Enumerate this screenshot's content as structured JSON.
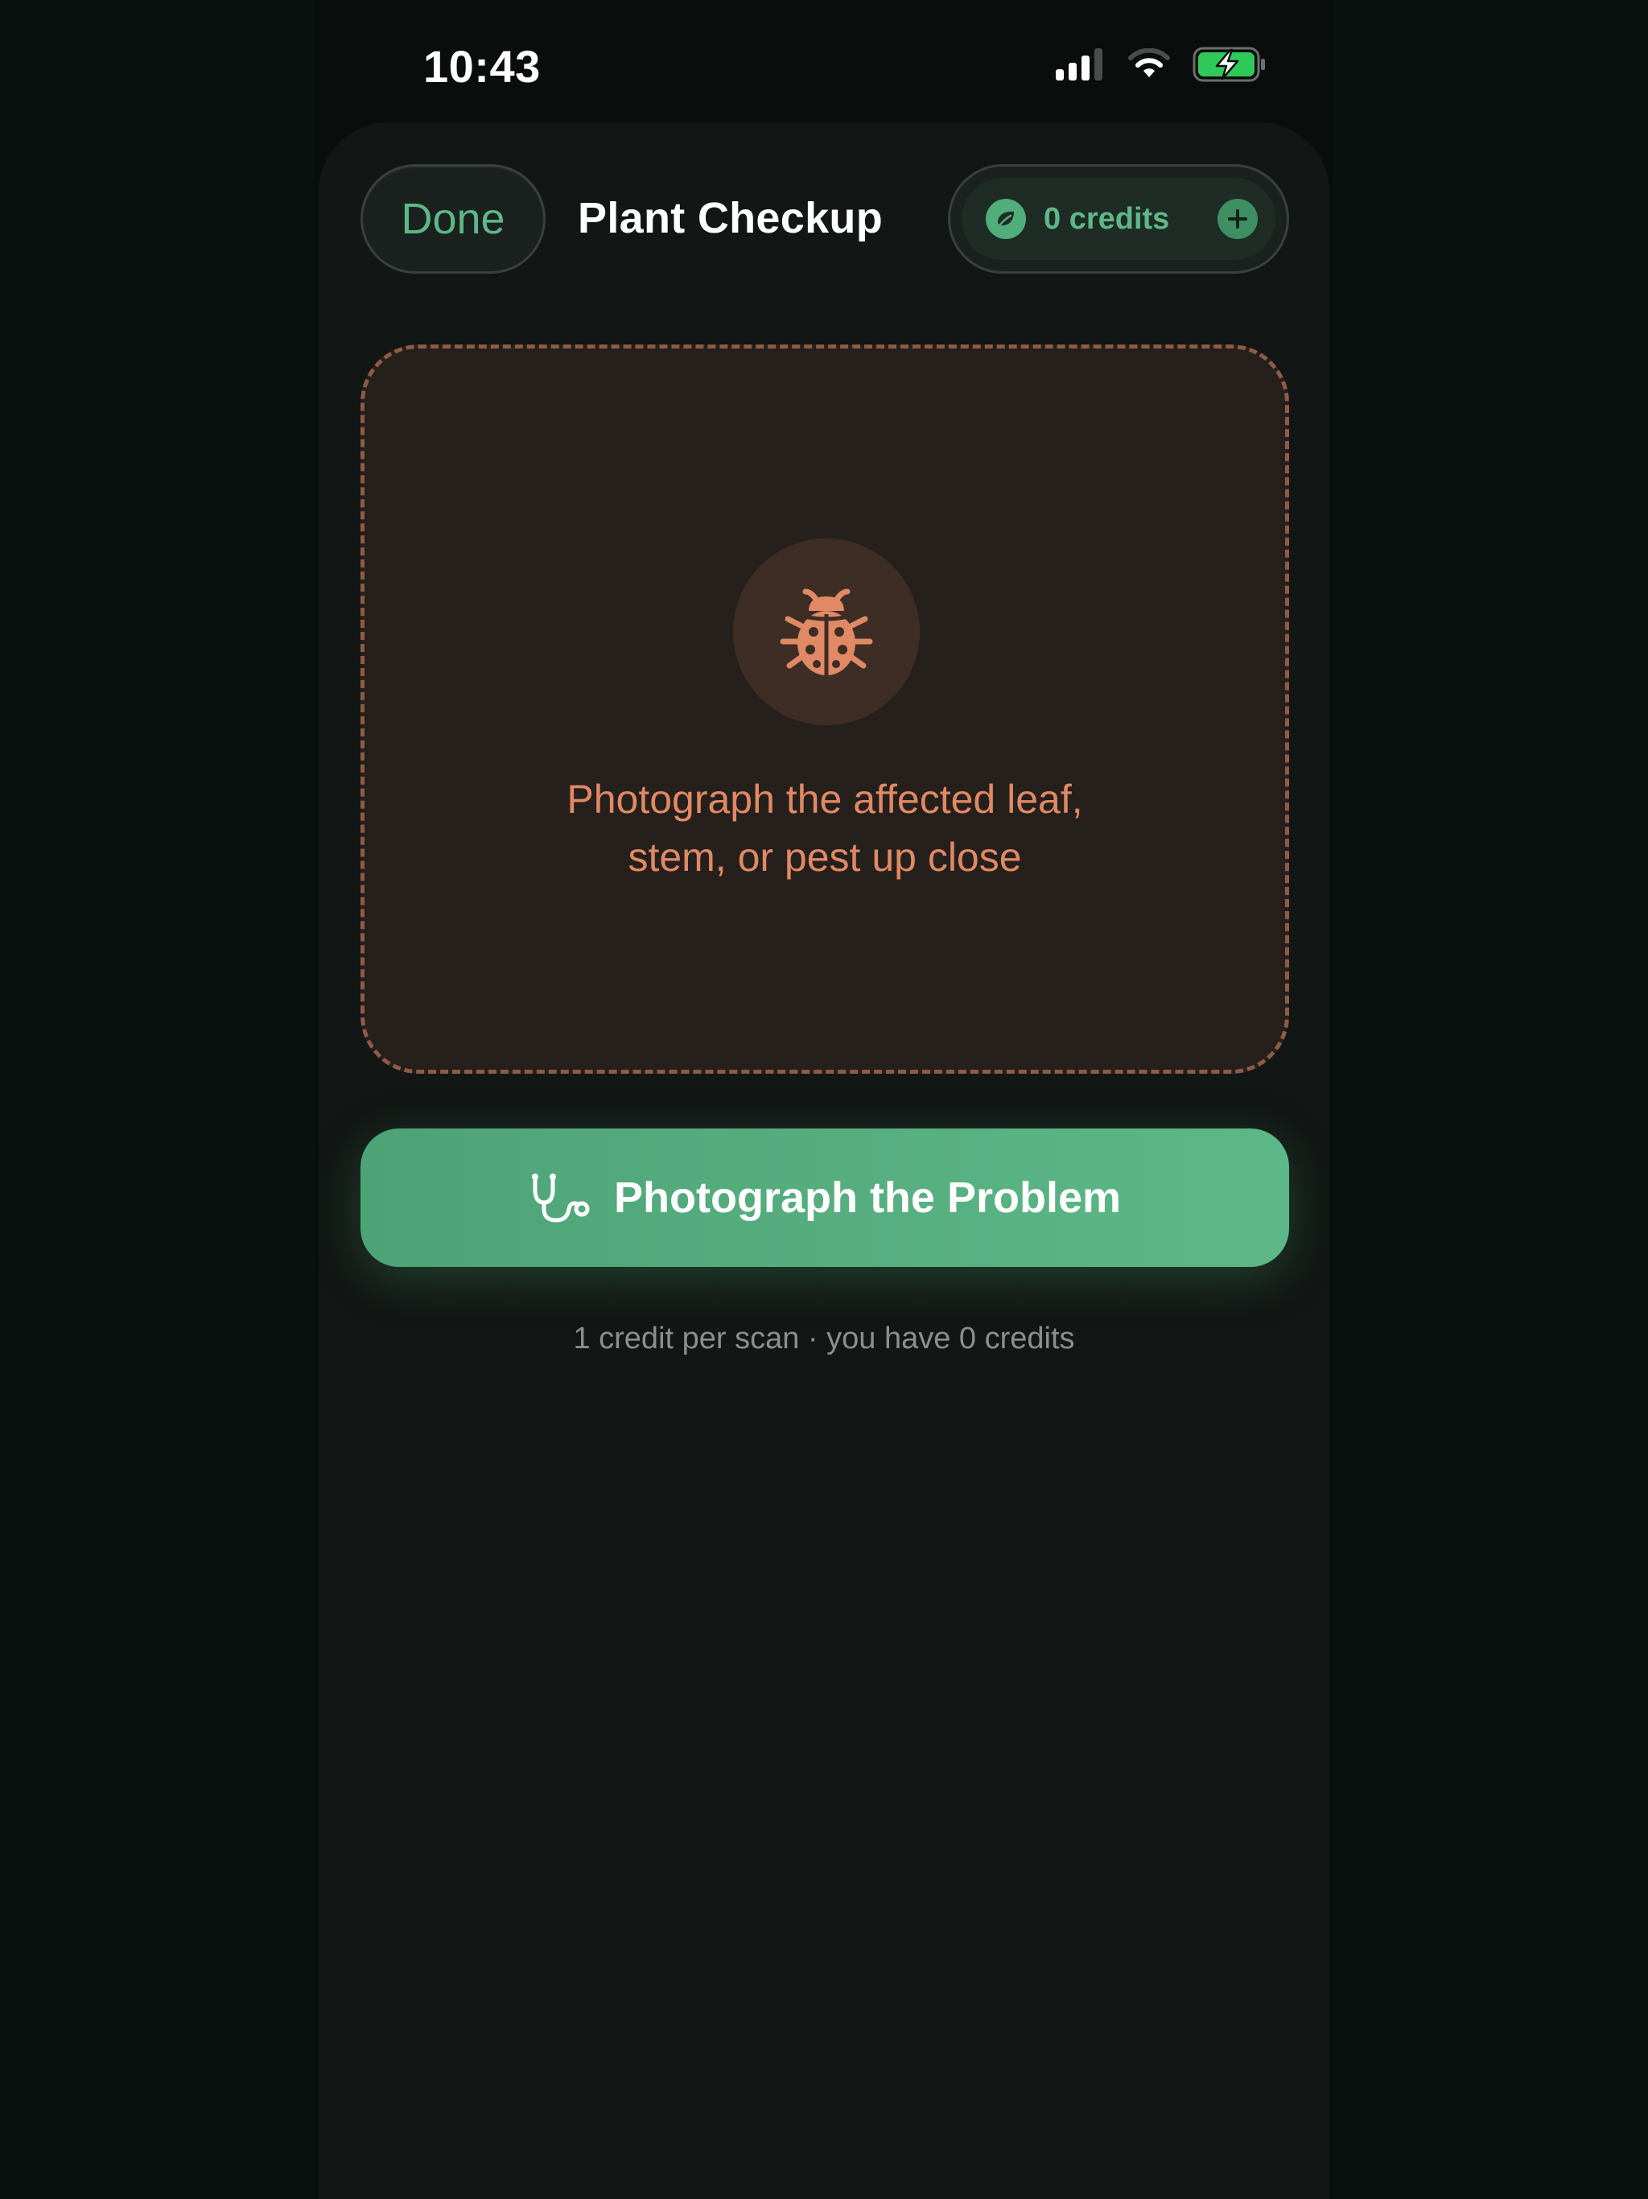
{
  "status_bar": {
    "time": "10:43",
    "icons": [
      "cellular-signal-icon",
      "wifi-icon",
      "battery-charging-icon"
    ],
    "battery_color": "#2fc95a"
  },
  "header": {
    "done_label": "Done",
    "title": "Plant Checkup",
    "credits_label": "0 credits",
    "credits_icon": "leaf-icon",
    "add_icon": "plus-icon"
  },
  "drop_zone": {
    "icon": "ladybug-icon",
    "hint_line1": "Photograph the affected leaf,",
    "hint_line2": "stem, or pest up close"
  },
  "primary_action": {
    "icon": "stethoscope-icon",
    "label": "Photograph the Problem"
  },
  "footnote": "1 credit per scan · you have 0 credits",
  "colors": {
    "accent_green": "#5db887",
    "warning_orange": "#e08964",
    "sheet_background": "#121614"
  }
}
